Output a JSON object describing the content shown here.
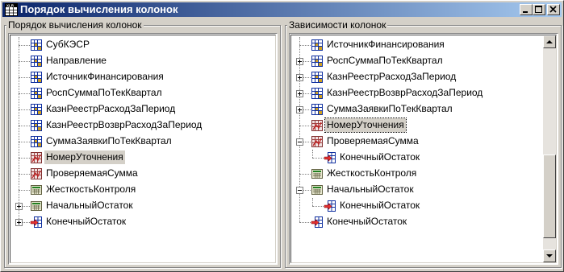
{
  "window": {
    "title": "Порядок вычисления колонок",
    "icon": "grid-app-icon"
  },
  "left_panel": {
    "legend": "Порядок вычисления колонок",
    "items": [
      {
        "label": "СубКЭСР",
        "icon": "column-icon",
        "selected": false
      },
      {
        "label": "Направление",
        "icon": "column-icon",
        "selected": false
      },
      {
        "label": "ИсточникФинансирования",
        "icon": "column-icon",
        "selected": false
      },
      {
        "label": "РоспСуммаПоТекКвартал",
        "icon": "column-icon",
        "selected": false
      },
      {
        "label": "КазнРеестрРасходЗаПериод",
        "icon": "column-icon",
        "selected": false
      },
      {
        "label": "КазнРеестрВозврРасходЗаПериод",
        "icon": "column-icon",
        "selected": false
      },
      {
        "label": "СуммаЗаявкиПоТекКвартал",
        "icon": "column-icon",
        "selected": false
      },
      {
        "label": "НомерУточнения",
        "icon": "formula-icon",
        "selected": true
      },
      {
        "label": "ПроверяемаяСумма",
        "icon": "formula-icon",
        "selected": false
      },
      {
        "label": "ЖесткостьКонтроля",
        "icon": "calculator-icon",
        "selected": false
      },
      {
        "label": "НачальныйОстаток",
        "icon": "calculator-icon",
        "selected": false
      },
      {
        "label": "КонечныйОстаток",
        "icon": "arrow-column-icon",
        "selected": false
      }
    ]
  },
  "right_panel": {
    "legend": "Зависимости колонок",
    "items": [
      {
        "label": "ИсточникФинансирования",
        "icon": "column-icon",
        "level": 0
      },
      {
        "label": "РоспСуммаПоТекКвартал",
        "icon": "column-icon",
        "level": 0
      },
      {
        "label": "КазнРеестрРасходЗаПериод",
        "icon": "column-icon",
        "level": 0
      },
      {
        "label": "КазнРеестрВозврРасходЗаПериод",
        "icon": "column-icon",
        "level": 0
      },
      {
        "label": "СуммаЗаявкиПоТекКвартал",
        "icon": "column-icon",
        "level": 0
      },
      {
        "label": "НомерУточнения",
        "icon": "formula-icon",
        "level": 0
      },
      {
        "label": "ПроверяемаяСумма",
        "icon": "formula-icon",
        "level": 0
      },
      {
        "label": "КонечныйОстаток",
        "icon": "arrow-column-icon",
        "level": 1
      },
      {
        "label": "ЖесткостьКонтроля",
        "icon": "calculator-icon",
        "level": 0
      },
      {
        "label": "НачальныйОстаток",
        "icon": "calculator-icon",
        "level": 0
      },
      {
        "label": "КонечныйОстаток",
        "icon": "arrow-column-icon",
        "level": 1
      },
      {
        "label": "КонечныйОстаток",
        "icon": "arrow-column-icon",
        "level": 0
      }
    ]
  },
  "colors": {
    "title_start": "#0a246a",
    "title_end": "#a6caf0",
    "selection_focus": "#0a246a"
  }
}
